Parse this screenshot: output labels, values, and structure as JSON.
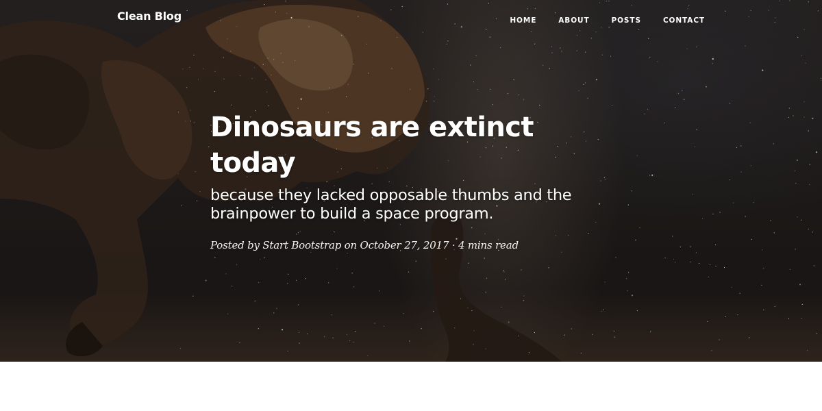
{
  "navbar": {
    "brand": "Clean Blog",
    "items": [
      {
        "label": "HOME"
      },
      {
        "label": "ABOUT"
      },
      {
        "label": "POSTS"
      },
      {
        "label": "CONTACT"
      }
    ]
  },
  "post": {
    "title": "Dinosaurs are extinct today",
    "subtitle": "because they lacked opposable thumbs and the brainpower to build a space program.",
    "meta": "Posted by Start Bootstrap on October 27, 2017 · 4 mins read"
  },
  "colors": {
    "text_on_hero": "#ffffff",
    "body_text": "#212529",
    "page_background": "#ffffff"
  }
}
